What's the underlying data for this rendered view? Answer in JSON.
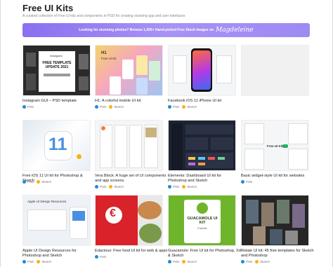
{
  "header": {
    "title": "Free UI Kits",
    "subtitle": "A curated collection of Free UI kits and components in PSD for creating stunning app and user interfaces"
  },
  "banner": {
    "text": "Looking for stunning photos? Browse 1,500+ Hand-picked Free Stock Images on",
    "brand": "Magdeleine"
  },
  "tags": {
    "psd": "PSD",
    "sketch": "Sketch"
  },
  "thumb_text": {
    "instagram_title": "Instagram",
    "instagram_main": "FREE TEMPLATE UPDATE 2021",
    "h1_title": "H1",
    "h1_main": "Free UI Kit",
    "ios_number": "11",
    "basic_widget": "Free UI Kit",
    "guacamole_title": "GUACAMOLE UI KIT",
    "guacamole_sub": "Freebie",
    "apple_title": "Apple UI Design Resources"
  },
  "cards": [
    {
      "caption": "Instagram GUI – PSD template",
      "tags": [
        "PSD"
      ]
    },
    {
      "caption": "H1: A colorful mobile UI kit",
      "tags": [
        "PSD",
        "Sketch"
      ]
    },
    {
      "caption": "Facebook iOS 11 iPhone UI kit",
      "tags": [
        "PSD",
        "Sketch"
      ]
    },
    {
      "caption": "",
      "tags": []
    },
    {
      "caption": "Free iOS 11 UI kit for Photoshop & Sketch",
      "tags": [
        "PSD",
        "Sketch"
      ]
    },
    {
      "caption": "Vera Block: A huge set of UI components and app screens",
      "tags": [
        "PSD",
        "Sketch"
      ]
    },
    {
      "caption": "Elements: Dashboard UI kit for Photoshop and Sketch",
      "tags": [
        "PSD",
        "Sketch"
      ]
    },
    {
      "caption": "Basic widget-style UI kit for websites",
      "tags": [
        "PSD"
      ]
    },
    {
      "caption": "Apple UI Design Resources for Photoshop and Sketch",
      "tags": [
        "PSD",
        "Sketch"
      ]
    },
    {
      "caption": "Edacious: Free food UI kit for web & apps",
      "tags": [
        "PSD"
      ]
    },
    {
      "caption": "Guacamole: Free UI kit for Photoshop, Xd & Sketch",
      "tags": [
        "PSD",
        "Sketch"
      ]
    },
    {
      "caption": "Relate UI kit: 45 free templates for Sketch and Photoshop",
      "tags": [
        "PSD",
        "Sketch"
      ]
    }
  ]
}
